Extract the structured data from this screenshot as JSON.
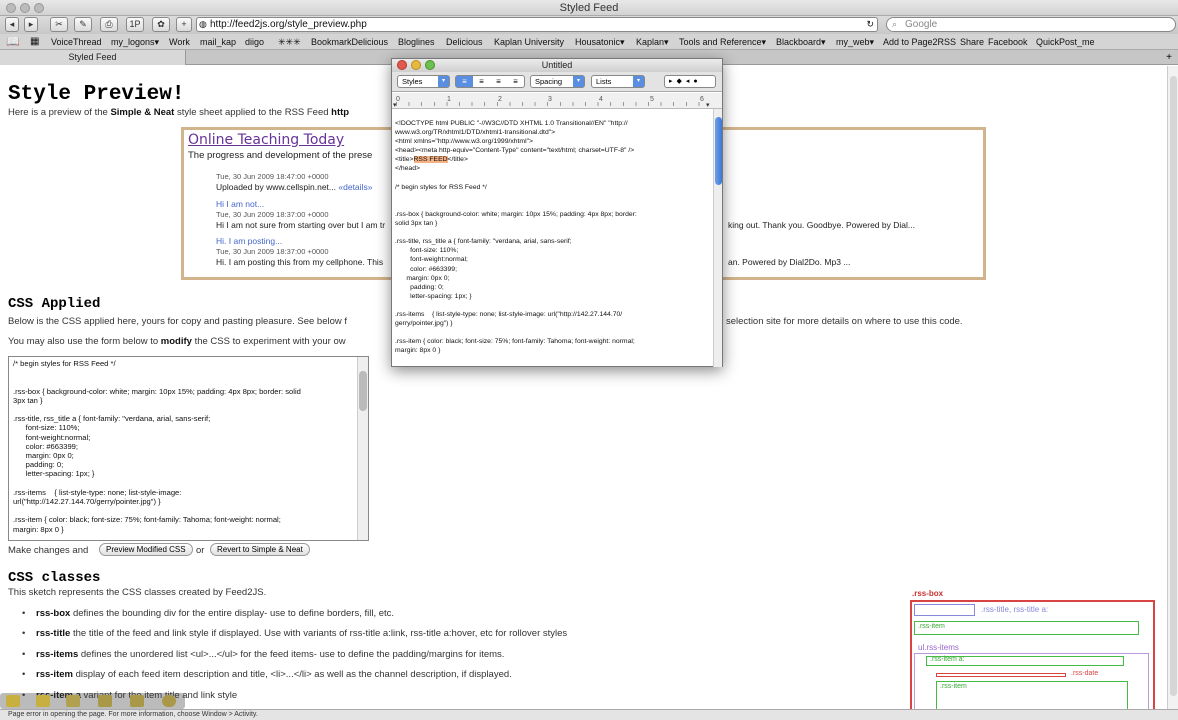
{
  "browser": {
    "window_title": "Styled Feed",
    "url": "http://feed2js.org/style_preview.php",
    "search_placeholder": "Google",
    "tab_label": "Styled Feed",
    "bookmarks": [
      "VoiceThread",
      "my_logons▾",
      "Work",
      "mail_kap",
      "diigo",
      "✳✳✳",
      "BookmarkDelicious",
      "Bloglines",
      "Delicious",
      "Kaplan University",
      "Housatonic▾",
      "Kaplan▾",
      "Tools and Reference▾",
      "Blackboard▾",
      "my_web▾",
      "Add to Page2RSS",
      "Share",
      "Facebook",
      "QuickPost_me"
    ],
    "status_text": "Page error in opening the page. For more information, choose Window > Activity."
  },
  "page": {
    "title": "Style Preview!",
    "intro_prefix": "Here is a preview of the ",
    "intro_bold": "Simple & Neat",
    "intro_mid": " style sheet applied to the RSS Feed ",
    "intro_link": "http",
    "feed": {
      "title": "Online Teaching Today",
      "description": "The progress and development of the prese",
      "items": [
        {
          "date": "Tue, 30 Jun 2009 18:47:00 +0000",
          "text": "Uploaded by www.cellspin.net...",
          "details": "«details»"
        },
        {
          "title": "Hi I am not...",
          "date": "Tue, 30 Jun 2009 18:37:00 +0000",
          "text": "Hi I am not sure from starting over but I am tr",
          "tail": "king out. Thank you. Goodbye. Powered by Dial..."
        },
        {
          "title": "Hi. I am posting...",
          "date": "Tue, 30 Jun 2009 18:37:00 +0000",
          "text": "Hi. I am posting this from my cellphone. This",
          "tail": "an. Powered by Dial2Do. Mp3 ..."
        }
      ]
    },
    "css_applied_heading": "CSS Applied",
    "css_applied_text": "Below is the CSS applied here, yours for copy and pasting pleasure. See below f",
    "css_applied_tail": "selection site for more details on where to use this code.",
    "modify_prefix": "You may also use the form below to ",
    "modify_bold": "modify",
    "modify_suffix": " the CSS to experiment with your ow",
    "css_code": "/* begin styles for RSS Feed */\n\n\n.rss-box { background-color: white; margin: 10px 15%; padding: 4px 8px; border: solid\n3px tan }\n\n.rss-title, rss_title a { font-family: \"verdana, arial, sans-serif;\n      font-size: 110%;\n      font-weight:normal;\n      color: #663399;\n      margin: 0px 0;\n      padding: 0;\n      letter-spacing: 1px; }\n\n.rss-items    { list-style-type: none; list-style-image:\nurl(\"http://142.27.144.70/gerry/pointer.jpg\") }\n\n.rss-item { color: black; font-size: 75%; font-family: Tahoma; font-weight: normal;\nmargin: 8px 0 }",
    "make_changes": "Make changes and",
    "preview_button": "Preview Modified CSS",
    "or": "or",
    "revert_button": "Revert to Simple & Neat",
    "css_classes_heading": "CSS classes",
    "css_classes_intro": "This sketch represents the CSS classes created by Feed2JS.",
    "classes": [
      {
        "name": "rss-box",
        "desc": " defines the bounding div for the entire display- use to define borders, fill, etc."
      },
      {
        "name": "rss-title",
        "desc": " the title of the feed and link style if displayed. Use with variants of rss-title a:link, rss-title a:hover, etc for rollover styles"
      },
      {
        "name": "rss-items",
        "desc": " defines the unordered list <ul>...</ul> for the feed items- use to define the padding/margins for items."
      },
      {
        "name": "rss-item",
        "desc": " display of each feed item description and title, <li>...</li> as well as the channel description, if displayed."
      },
      {
        "name": "rss-item a",
        "desc": " variant for the item title and link style"
      }
    ],
    "diagram": {
      "box": ".rss-box",
      "title": ".rss-title, rss-title a:",
      "item1": ".rss-item",
      "items": "ul.rss-items",
      "item_a": ".rss-item a:",
      "date": ".rss-date",
      "item2": ".rss-item"
    }
  },
  "editor": {
    "title": "Untitled",
    "styles": "Styles",
    "spacing": "Spacing",
    "lists": "Lists",
    "ruler_numbers": [
      "0",
      "1",
      "2",
      "3",
      "4",
      "5",
      "6"
    ],
    "text_before": "<!DOCTYPE html PUBLIC \"-//W3C//DTD XHTML 1.0 Transitional//EN\" \"http://\nwww.w3.org/TR/xhtml1/DTD/xhtml1-transitional.dtd\">\n<html xmlns=\"http://www.w3.org/1999/xhtml\">\n<head><meta http-equiv=\"Content-Type\" content=\"text/html; charset=UTF-8\" />\n<title>",
    "highlight": "RSS FEED",
    "text_after": "</title>\n</head>\n\n/* begin styles for RSS Feed */\n\n\n.rss-box { background-color: white; margin: 10px 15%; padding: 4px 8px; border:\nsolid 3px tan }\n\n.rss-title, rss_title a { font-family: \"verdana, arial, sans-serif;\n        font-size: 110%;\n        font-weight:normal;\n        color: #663399;\n      margin: 0px 0;\n        padding: 0;\n        letter-spacing: 1px; }\n\n.rss-items    { list-style-type: none; list-style-image: url(\"http://142.27.144.70/\ngerry/pointer.jpg\") }\n\n.rss-item { color: black; font-size: 75%; font-family: Tahoma; font-weight: normal;\nmargin: 8px 0 }"
  }
}
